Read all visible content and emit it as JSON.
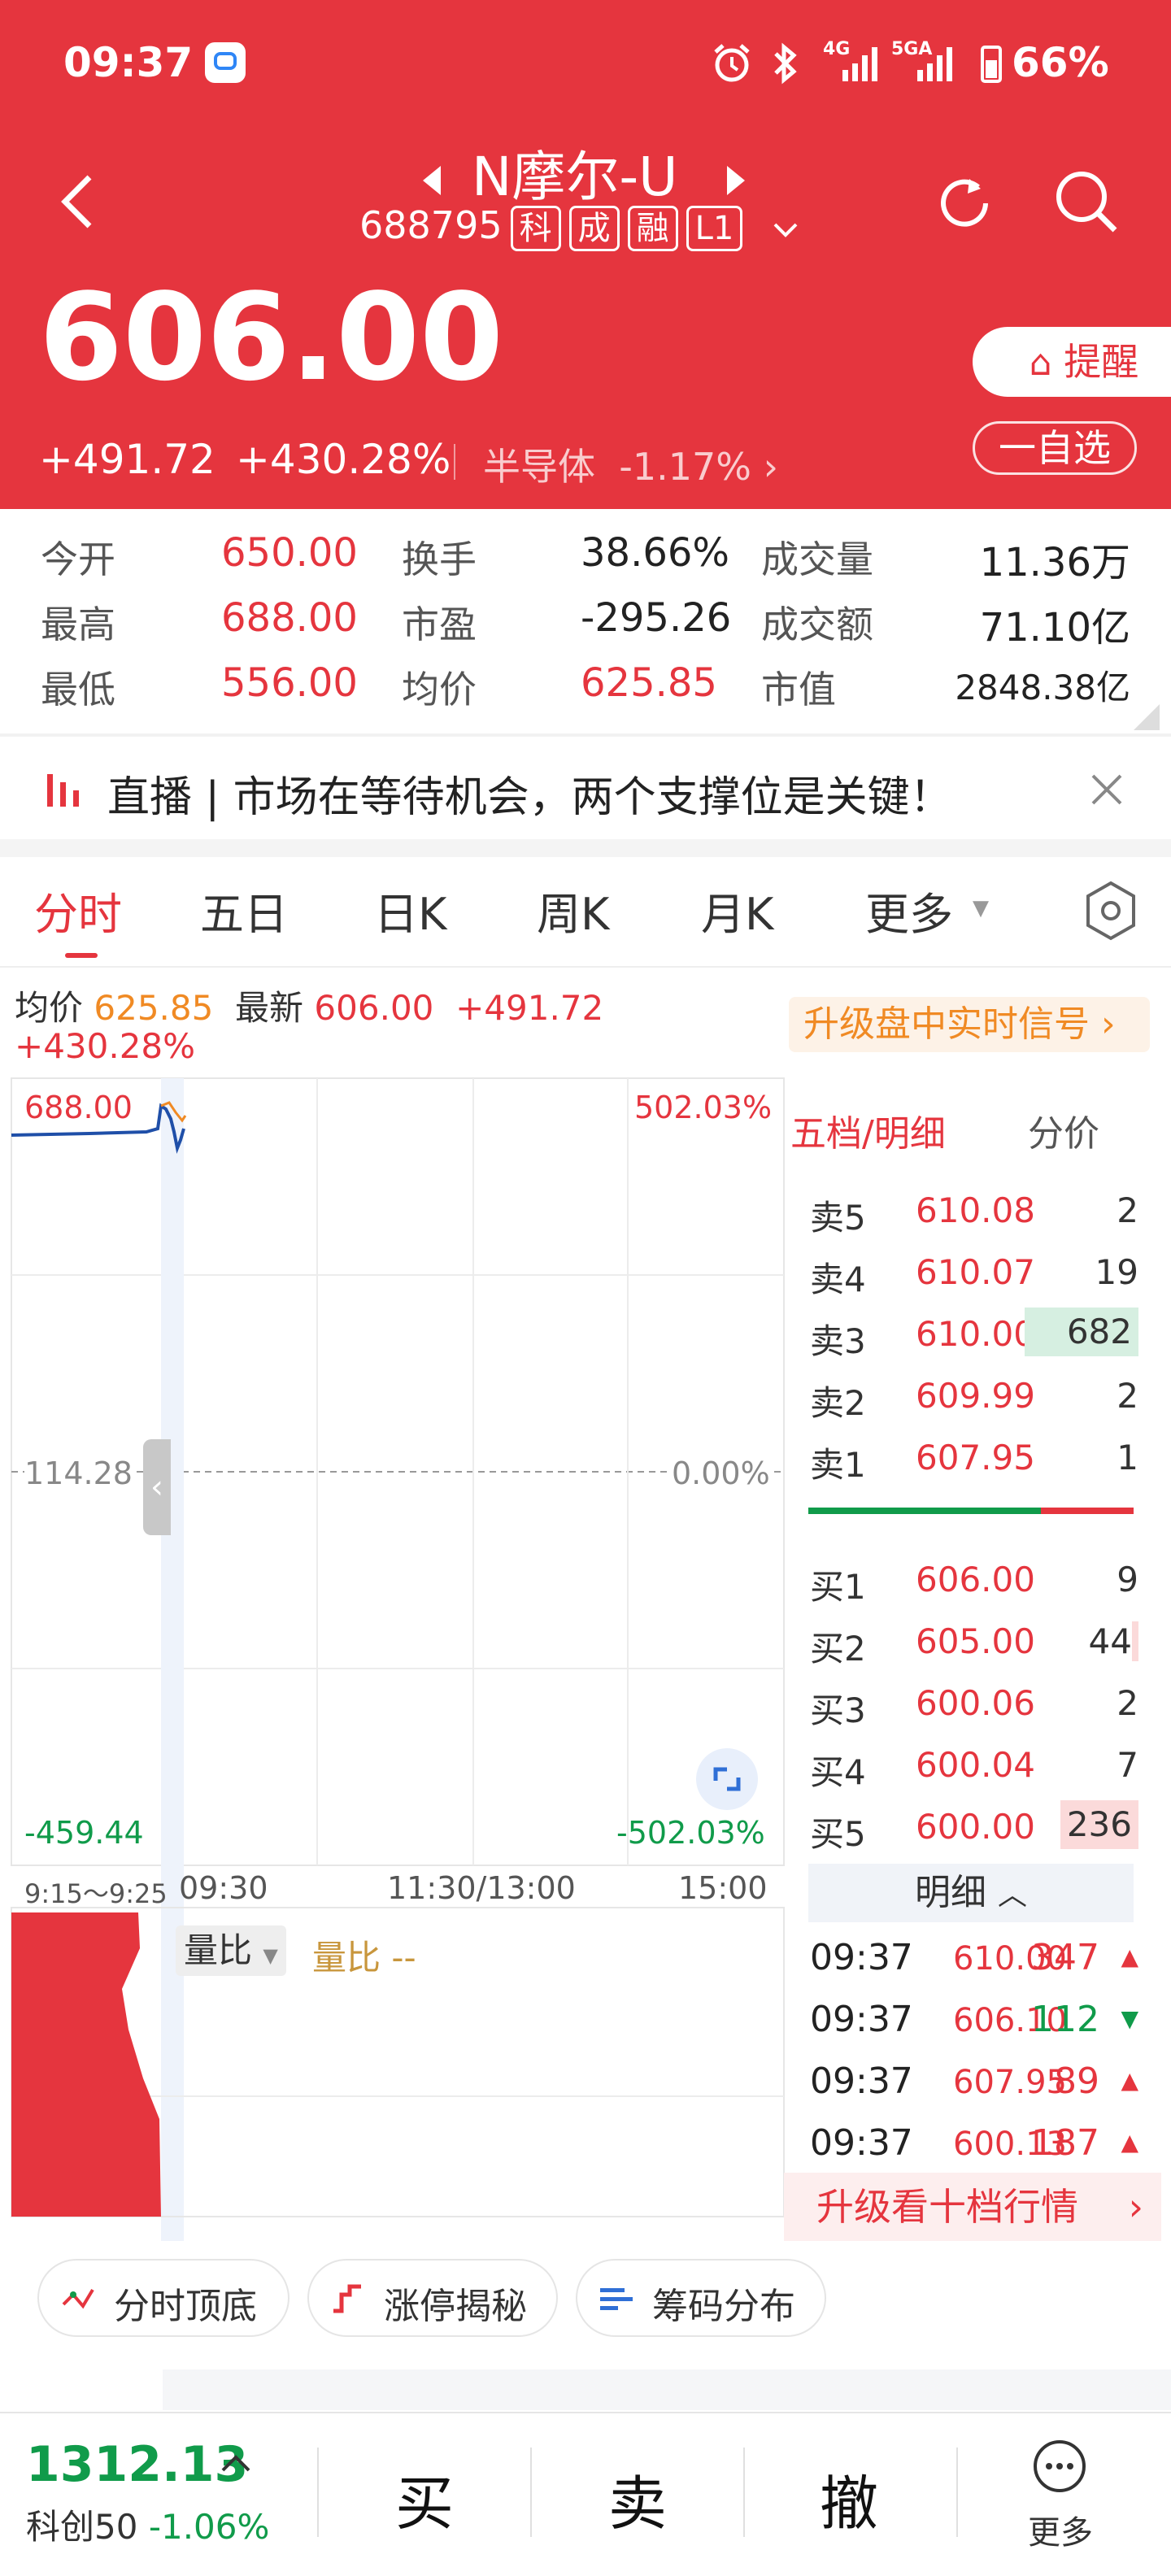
{
  "status": {
    "time": "09:37",
    "battery": "66%",
    "net1": "4G",
    "net2": "5GA"
  },
  "stock": {
    "name": "N摩尔-U",
    "code": "688795",
    "tags": [
      "科",
      "成",
      "融",
      "L1"
    ],
    "price": "606.00",
    "change": "+491.72",
    "change_pct": "+430.28%",
    "sector": "半导体",
    "sector_pct": "-1.17%",
    "remind": "提醒",
    "watch": "一自选"
  },
  "stats": [
    {
      "l1": "今开",
      "v1": "650.00",
      "l2": "换手",
      "v2": "38.66%",
      "l3": "成交量",
      "v3": "11.36万"
    },
    {
      "l1": "最高",
      "v1": "688.00",
      "l2": "市盈",
      "v2": "-295.26",
      "l3": "成交额",
      "v3": "71.10亿"
    },
    {
      "l1": "最低",
      "v1": "556.00",
      "l2": "均价",
      "v2": "625.85",
      "l3": "市值",
      "v3": "2848.38亿"
    }
  ],
  "live": {
    "text": "直播 | 市场在等待机会，两个支撑位是关键！"
  },
  "tabs": [
    "分时",
    "五日",
    "日K",
    "周K",
    "月K",
    "更多"
  ],
  "info": {
    "avg_label": "均价",
    "avg": "625.85",
    "last_label": "最新",
    "last": "606.00",
    "chg": "+491.72",
    "pct": "+430.28%",
    "upgrade": "升级盘中实时信号"
  },
  "chart": {
    "y_top": "688.00",
    "y_mid": "114.28",
    "y_bot": "-459.44",
    "p_top": "502.03%",
    "p_mid": "0.00%",
    "p_bot": "-502.03%",
    "x_pre": "9:15～9:25",
    "x1": "09:30",
    "x2": "11:30/13:00",
    "x3": "15:00",
    "vol_label": "量比",
    "vol_value": "量比 --"
  },
  "ob": {
    "header1": "五档/明细",
    "header2": "分价",
    "asks": [
      {
        "n": "卖5",
        "p": "610.08",
        "q": "2"
      },
      {
        "n": "卖4",
        "p": "610.07",
        "q": "19"
      },
      {
        "n": "卖3",
        "p": "610.00",
        "q": "682"
      },
      {
        "n": "卖2",
        "p": "609.99",
        "q": "2"
      },
      {
        "n": "卖1",
        "p": "607.95",
        "q": "1"
      }
    ],
    "bids": [
      {
        "n": "买1",
        "p": "606.00",
        "q": "9"
      },
      {
        "n": "买2",
        "p": "605.00",
        "q": "44"
      },
      {
        "n": "买3",
        "p": "600.06",
        "q": "2"
      },
      {
        "n": "买4",
        "p": "600.04",
        "q": "7"
      },
      {
        "n": "买5",
        "p": "600.00",
        "q": "236"
      }
    ],
    "detail_label": "明细",
    "details": [
      {
        "t": "09:37",
        "p": "610.00",
        "q": "347",
        "dir": "up"
      },
      {
        "t": "09:37",
        "p": "606.10",
        "q": "112",
        "dir": "down"
      },
      {
        "t": "09:37",
        "p": "607.95",
        "q": "89",
        "dir": "up"
      },
      {
        "t": "09:37",
        "p": "600.13",
        "q": "187",
        "dir": "up"
      }
    ],
    "upgrade10": "升级看十档行情"
  },
  "chips": [
    "分时顶底",
    "涨停揭秘",
    "筹码分布"
  ],
  "bottom": {
    "index_value": "1312.13",
    "index_name": "科创50",
    "index_pct": "-1.06%",
    "buy": "买",
    "sell": "卖",
    "cancel": "撤",
    "more": "更多"
  },
  "colors": {
    "red": "#e5353e",
    "green": "#109b4a",
    "blue": "#1f4fa8",
    "orange": "#f08a24"
  }
}
